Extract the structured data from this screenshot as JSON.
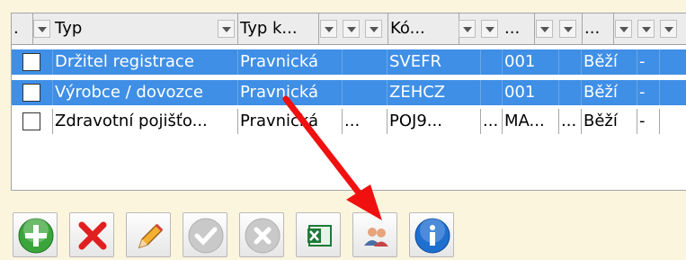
{
  "grid": {
    "headers": [
      ".",
      "Typ",
      "Typ k...",
      "",
      "",
      "Kó...",
      "",
      "",
      "...",
      "",
      "",
      "...",
      "",
      ""
    ],
    "rows": [
      {
        "checked": false,
        "typ": "Držitel registrace",
        "typ_k": "Pravnická",
        "col3": "",
        "kod": "SVEFR",
        "col5": "",
        "col6": "001",
        "col7": "",
        "stav": "Běží",
        "col9": "-"
      },
      {
        "checked": false,
        "typ": "Výrobce / dovozce",
        "typ_k": "Pravnická",
        "col3": "",
        "kod": "ZEHCZ",
        "col5": "",
        "col6": "001",
        "col7": "",
        "stav": "Běží",
        "col9": "-"
      },
      {
        "checked": false,
        "typ": "Zdravotní pojišťo...",
        "typ_k": "Pravnická",
        "col3": "...",
        "kod": "POJ9...",
        "col5": "...",
        "col6": "MA...",
        "col7": "...",
        "stav": "Běží",
        "col9": "-"
      }
    ]
  },
  "toolbar": {
    "buttons": [
      {
        "name": "add-button",
        "icon": "plus-circle-icon",
        "color": "#3aa53a"
      },
      {
        "name": "delete-button",
        "icon": "red-x-icon",
        "color": "#e02020"
      },
      {
        "name": "edit-button",
        "icon": "pencil-icon",
        "color": "#f0a020"
      },
      {
        "name": "confirm-button",
        "icon": "check-circle-icon",
        "color": "#c8c8c8"
      },
      {
        "name": "cancel-button",
        "icon": "x-circle-icon",
        "color": "#c8c8c8"
      },
      {
        "name": "excel-export-button",
        "icon": "excel-icon",
        "color": "#1f7a3a"
      },
      {
        "name": "users-button",
        "icon": "users-icon",
        "color": "#4a6fa5"
      },
      {
        "name": "info-button",
        "icon": "info-icon",
        "color": "#1e6fd0"
      }
    ]
  },
  "colors": {
    "selection": "#3f8fe6",
    "annotation_arrow": "#f01010",
    "background": "#fbf5de"
  }
}
